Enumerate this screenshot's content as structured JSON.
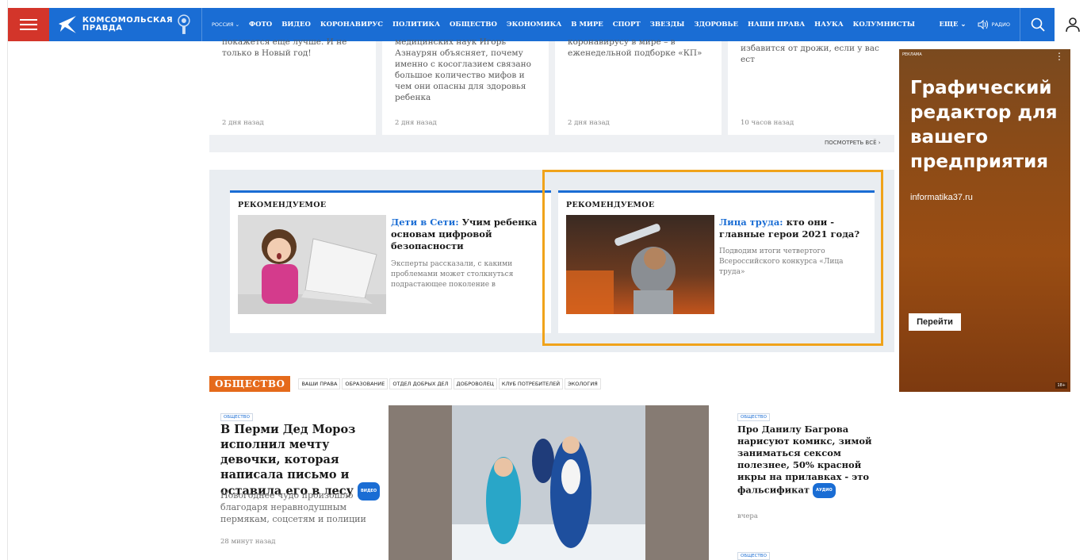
{
  "topbar": {
    "logo_text_line1": "КОМСОМОЛЬСКАЯ",
    "logo_text_line2": "ПРАВДА",
    "region": "РОССИЯ",
    "nav": [
      "ФОТО",
      "ВИДЕО",
      "КОРОНАВИРУС",
      "ПОЛИТИКА",
      "ОБЩЕСТВО",
      "ЭКОНОМИКА",
      "В МИРЕ",
      "СПОРТ",
      "ЗВЕЗДЫ",
      "ЗДОРОВЬЕ",
      "НАШИ ПРАВА",
      "НАУКА",
      "КОЛУМНИСТЫ"
    ],
    "more": "ЕЩЕ",
    "radio": "РАДИО"
  },
  "top_cards": [
    {
      "text": "покажется еще лучше. И не только в Новый год!",
      "time": "2 дня назад"
    },
    {
      "text": "медицинских наук Игорь Азнаурян объясняет, почему именно с косоглазием связано большое количество мифов и чем они опасны для здоровья ребенка",
      "time": "2 дня назад"
    },
    {
      "text": "коронавирусу в мире – в еженедельной подборке «КП»",
      "time": "2 дня назад"
    },
    {
      "text": "избавится от дрожи, если у вас ест",
      "time": "10 часов назад"
    }
  ],
  "see_all": "ПОСМОТРЕТЬ ВСЁ",
  "recommended": [
    {
      "head": "РЕКОМЕНДУЕМОЕ",
      "kicker": "Дети в Сети:",
      "title": "Учим ребенка основам цифровой безопасности",
      "desc": "Эксперты рассказали, с какими проблемами может столкнуться подрастающее поколение в"
    },
    {
      "head": "РЕКОМЕНДУЕМОЕ",
      "kicker": "Лица труда:",
      "title": "кто они - главные герои 2021 года?",
      "desc": "Подводим итоги четвертого Всероссийского конкурса «Лица труда»"
    }
  ],
  "ad": {
    "label": "РЕКЛАМА",
    "headline": "Графический редактор для вашего предприятия",
    "domain": "informatika37.ru",
    "button": "Перейти",
    "age": "18+"
  },
  "section": {
    "badge": "ОБЩЕСТВО",
    "subtags": [
      "ВАШИ ПРАВА",
      "ОБРАЗОВАНИЕ",
      "ОТДЕЛ ДОБРЫХ ДЕЛ",
      "ДОБРОВОЛЕЦ",
      "КЛУБ ПОТРЕБИТЕЛЕЙ",
      "ЭКОЛОГИЯ"
    ],
    "main": {
      "tag": "ОБЩЕСТВО",
      "title": "В Перми Дед Мороз исполнил мечту девочки, которая написала письмо и оставила его в лесу",
      "badge": "ВИДЕО",
      "lead": "Новогоднее чудо произошло благодаря неравнодушным пермякам, соцсетям и полиции",
      "time": "28 минут назад"
    },
    "side": {
      "tag": "ОБЩЕСТВО",
      "title": "Про Данилу Багрова нарисуют комикс, зимой заниматься сексом полезнее, 50% красной икры на прилавках - это фальсификат",
      "badge": "АУДИО",
      "time": "вчера"
    },
    "side2_tag": "ОБЩЕСТВО"
  },
  "colors": {
    "brand_blue": "#1a6dd4",
    "menu_red": "#d3352a",
    "section_orange": "#e56a1b",
    "highlight": "#f0a31a"
  }
}
